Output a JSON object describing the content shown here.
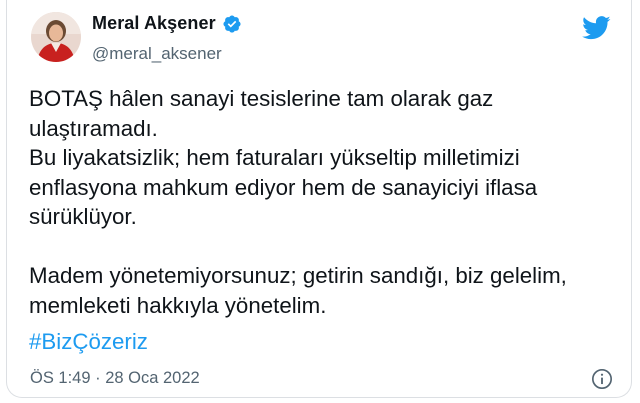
{
  "author": {
    "display_name": "Meral Akşener",
    "handle": "@meral_aksener",
    "verified": true,
    "avatar_icon": "profile-photo"
  },
  "tweet": {
    "lines_block1": [
      "BOTAŞ hâlen sanayi tesislerine tam olarak gaz",
      "ulaştıramadı.",
      "Bu liyakatsizlik; hem faturaları yükseltip milletimizi",
      "enflasyona mahkum ediyor hem de sanayiciyi iflasa",
      "sürüklüyor."
    ],
    "lines_block2": [
      "Madem yönetemiyorsunuz; getirin sandığı, biz gelelim,",
      "memleketi hakkıyla yönetelim."
    ],
    "hashtag": "#BizÇözeriz",
    "timestamp": "ÖS 1:49 · 28 Oca 2022"
  },
  "icons": {
    "brand": "twitter-bird-icon",
    "verified": "verified-badge-icon",
    "info": "info-icon"
  },
  "colors": {
    "brand_blue": "#1d9bf0",
    "text_primary": "#0f1419",
    "text_secondary": "#536471"
  }
}
